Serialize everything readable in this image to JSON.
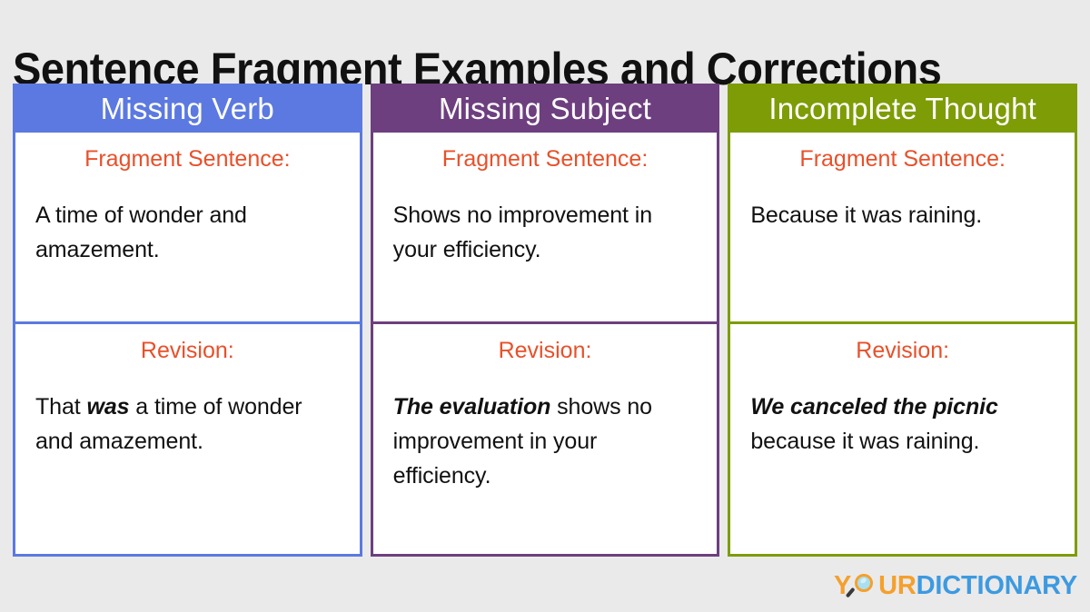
{
  "title": "Sentence Fragment Examples and Corrections",
  "colors": {
    "background": "#eaeaea",
    "title_text": "#111111",
    "label_orange": "#e8502a",
    "body_text": "#111111",
    "column_1": "#5b79e0",
    "column_2": "#6d3f7f",
    "column_3": "#7e9c06",
    "logo_orange": "#f5a02d",
    "logo_blue": "#3d9ae0"
  },
  "labels": {
    "fragment": "Fragment Sentence:",
    "revision": "Revision:"
  },
  "columns": [
    {
      "header": "Missing Verb",
      "fragment_label": "Fragment Sentence:",
      "fragment_text": "A time of wonder and amazement.",
      "revision_label": "Revision:",
      "revision_prefix": "That ",
      "revision_emphasis": "was",
      "revision_suffix": " a time of wonder and amazement.",
      "revision_text": "That was a time of wonder and amazement."
    },
    {
      "header": "Missing Subject",
      "fragment_label": "Fragment Sentence:",
      "fragment_text": "Shows no improvement in your efficiency.",
      "revision_label": "Revision:",
      "revision_prefix": "",
      "revision_emphasis": "The evaluation",
      "revision_suffix": " shows no improvement in your efficiency.",
      "revision_text": "The evaluation shows no improvement in your efficiency."
    },
    {
      "header": "Incomplete Thought",
      "fragment_label": "Fragment Sentence:",
      "fragment_text": "Because it was raining.",
      "revision_label": "Revision:",
      "revision_prefix": "",
      "revision_emphasis": "We canceled the picnic",
      "revision_suffix": " because it was raining.",
      "revision_text": "We canceled the picnic because it was raining."
    }
  ],
  "logo": {
    "part_your_1": "Y",
    "icon": "magnifying-glass-icon",
    "part_your_2": "UR",
    "part_dictionary": "DICTIONARY",
    "full_text": "YOURDICTIONARY"
  }
}
